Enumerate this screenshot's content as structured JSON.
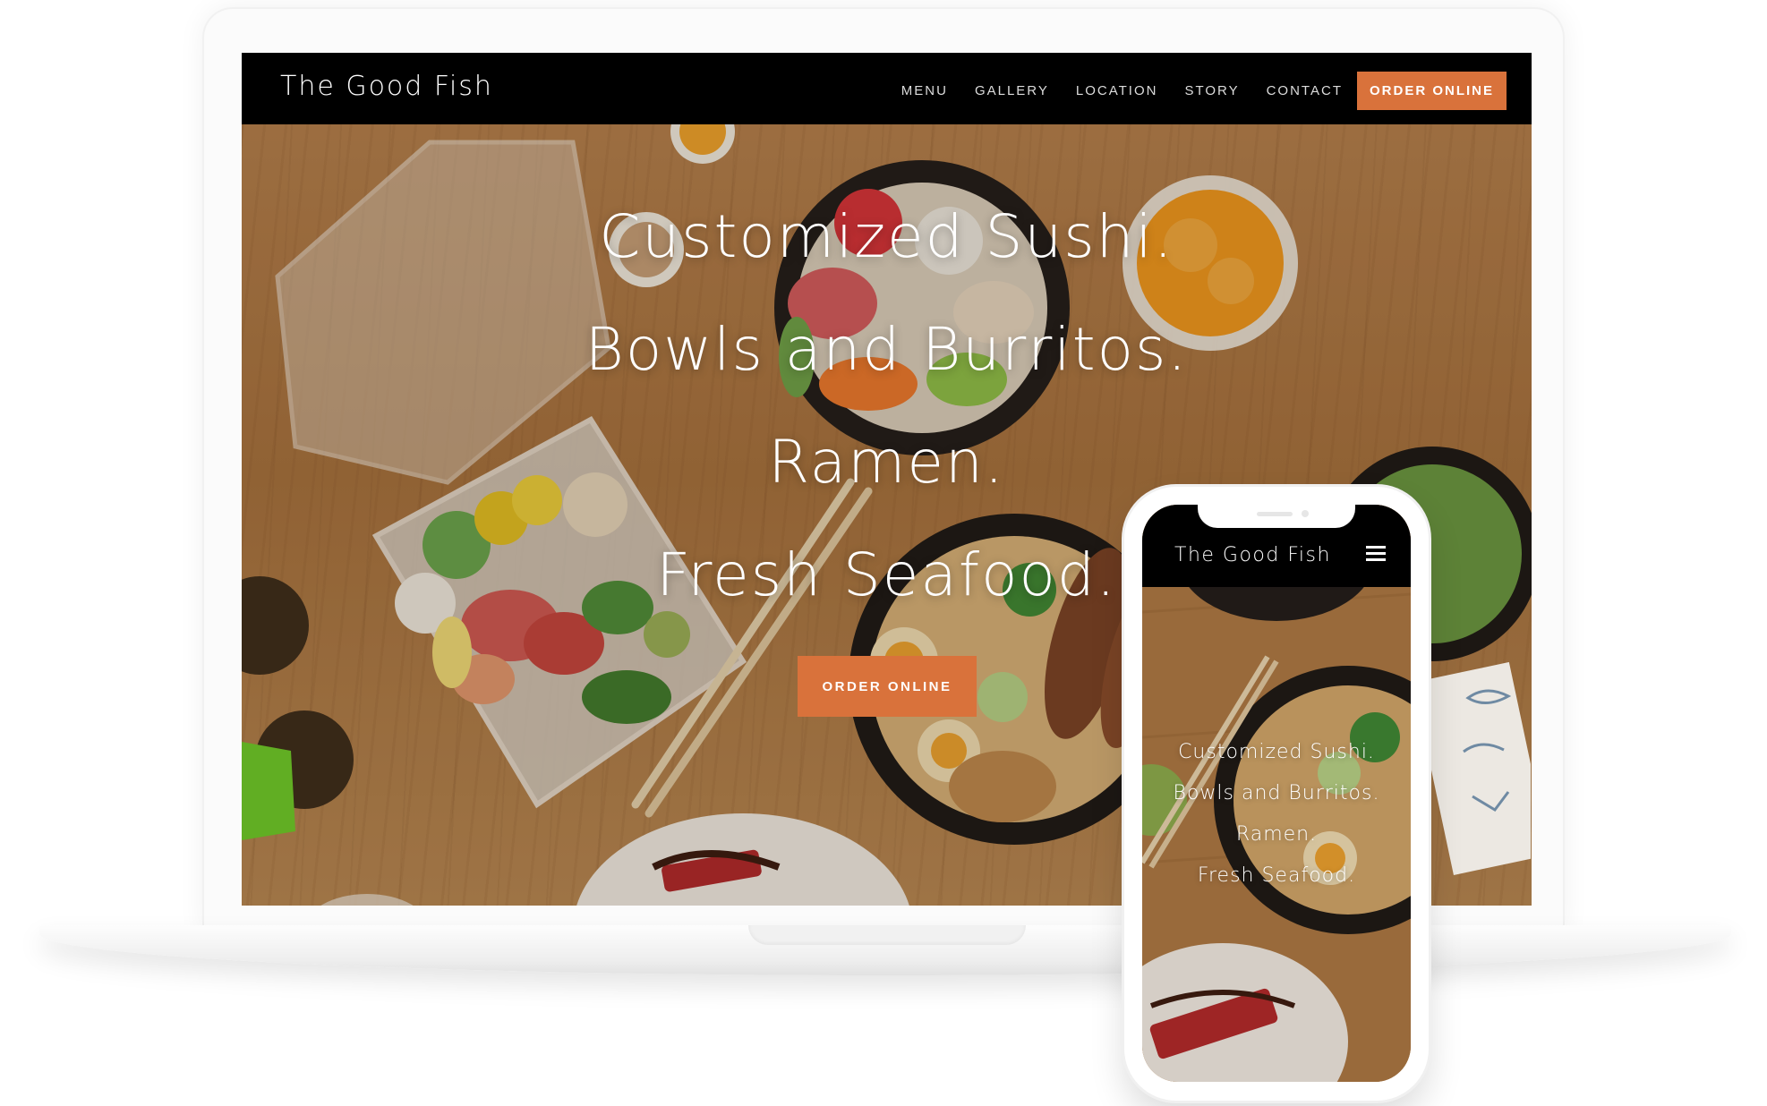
{
  "desktop": {
    "brand": "The Good Fish",
    "nav": [
      {
        "label": "MENU"
      },
      {
        "label": "GALLERY"
      },
      {
        "label": "LOCATION"
      },
      {
        "label": "STORY"
      },
      {
        "label": "CONTACT"
      }
    ],
    "nav_cta": "ORDER ONLINE",
    "hero_lines": [
      "Customized Sushi.",
      "Bowls and Burritos.",
      "Ramen.",
      "Fresh Seafood."
    ],
    "hero_cta": "ORDER ONLINE"
  },
  "mobile": {
    "brand": "The Good Fish",
    "menu_icon": "hamburger-icon",
    "hero_lines": [
      "Customized Sushi.",
      "Bowls and Burritos.",
      "Ramen.",
      "Fresh Seafood."
    ]
  },
  "colors": {
    "accent": "#d9723b",
    "nav_background": "#000000",
    "nav_text": "#dcdcdc"
  }
}
